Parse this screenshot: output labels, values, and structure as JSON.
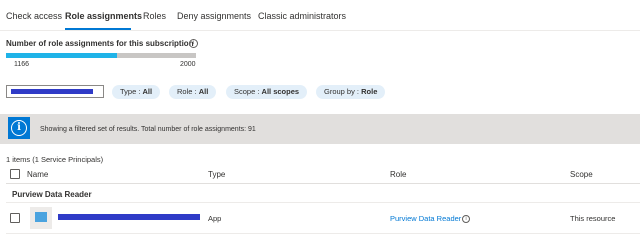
{
  "tabs": [
    {
      "label": "Check access",
      "active": false
    },
    {
      "label": "Role assignments",
      "active": true
    },
    {
      "label": "Roles",
      "active": false
    },
    {
      "label": "Deny assignments",
      "active": false
    },
    {
      "label": "Classic administrators",
      "active": false
    }
  ],
  "assignment_count": {
    "title": "Number of role assignments for this subscription",
    "current": "1166",
    "max": "2000",
    "fraction": 0.583
  },
  "filters": [
    {
      "key": "Type : ",
      "value": "All"
    },
    {
      "key": "Role : ",
      "value": "All"
    },
    {
      "key": "Scope : ",
      "value": "All scopes"
    },
    {
      "key": "Group by : ",
      "value": "Role"
    }
  ],
  "banner": {
    "icon": "info-icon",
    "text": "Showing a filtered set of results. Total number of role assignments: 91"
  },
  "table": {
    "items_count": "1 items (1 Service Principals)",
    "columns": [
      "Name",
      "Type",
      "Role",
      "Scope"
    ],
    "groups": [
      {
        "label": "Purview Data Reader",
        "rows": [
          {
            "type": "App",
            "role": "Purview Data Reader",
            "scope": "This resource"
          }
        ]
      }
    ]
  },
  "colors": {
    "accent": "#0078d4",
    "progress_fill": "#1fb3e8",
    "redaction": "#2f3bc7",
    "pill_bg": "#e3eff9",
    "banner_bg": "#e1dfdd"
  }
}
